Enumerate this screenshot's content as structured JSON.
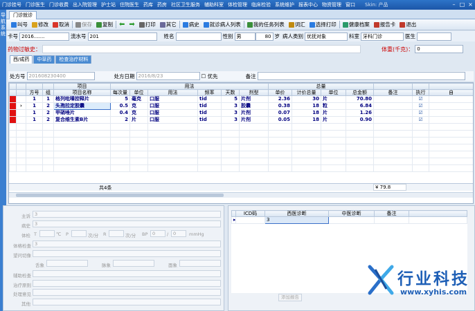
{
  "top_menu": [
    "门诊挂号",
    "门诊医生",
    "门诊收费",
    "出入院管理",
    "护士站",
    "住院医生",
    "药库",
    "药房",
    "社区卫生服务",
    "辅助科室",
    "体检管理",
    "临床检验",
    "系统维护",
    "报表中心",
    "物资管理",
    "窗口"
  ],
  "window_title_small": "Skin: 产品",
  "left_strip": "导航系统",
  "tab_main": "门诊就诊",
  "toolbar": {
    "items": [
      "叫号",
      "修改",
      "取消",
      "保存",
      "复制",
      "",
      "打印",
      "其它",
      "病史",
      "就诊病人列表",
      "我的任务列表",
      "词汇",
      "选择打印",
      "健康档案",
      "报告卡",
      "退出"
    ]
  },
  "patient": {
    "card_label": "卡号",
    "card_value": "2016.......",
    "serial_label": "流水号",
    "serial_value": "201",
    "name_label": "姓名",
    "name_value": "",
    "sex_label": "性别",
    "sex_value": "男",
    "age_value": "80",
    "age_unit": "岁",
    "category_label": "病人类别",
    "category_value": "优抚对象",
    "dept_label": "科室",
    "dept_value": "牙科门诊",
    "doctor_label": "医生",
    "doctor_value": ""
  },
  "allergy_label": "药物过敏史：",
  "weight_label": "体重(千克)：",
  "weight_value": "0",
  "sub_tabs": [
    "西/成药",
    "中草药",
    "检查治疗材料"
  ],
  "prescription": {
    "no_label": "处方号",
    "no_value": "201608230400",
    "date_label": "处方日期",
    "date_value": "2016/8/23",
    "priority_label": "优先",
    "note_label": "备注"
  },
  "grid": {
    "group_headers": {
      "project": "项目",
      "usage": "用法",
      "total": "总量"
    },
    "columns": [
      "方号",
      "组",
      "项目名称",
      "每次量",
      "单位",
      "用法",
      "频率",
      "天数",
      "剂型",
      "单价",
      "计价总量",
      "单位",
      "总金额",
      "备注",
      "执行",
      "自"
    ],
    "rows": [
      {
        "no": "1",
        "group": "1",
        "name": "格列吡嗪控释片",
        "dose": "5",
        "unit": "毫克",
        "route": "口服",
        "freq": "tid",
        "days": "5",
        "form": "片剂",
        "price": "2.36",
        "qty": "30",
        "qunit": "片",
        "amount": "70.80",
        "exec": "☑"
      },
      {
        "no": "1",
        "group": "2",
        "name": "头孢拉定胶囊",
        "dose": "0.5",
        "unit": "克",
        "route": "口服",
        "freq": "tid",
        "days": "3",
        "form": "胶囊",
        "price": "0.38",
        "qty": "18",
        "qunit": "粒",
        "amount": "6.84",
        "exec": "☑"
      },
      {
        "no": "1",
        "group": "2",
        "name": "甲硝唑片",
        "dose": "0.4",
        "unit": "克",
        "route": "口服",
        "freq": "tid",
        "days": "3",
        "form": "片剂",
        "price": "0.07",
        "qty": "18",
        "qunit": "片",
        "amount": "1.26",
        "exec": "☑"
      },
      {
        "no": "1",
        "group": "2",
        "name": "复合维生素B片",
        "dose": "2",
        "unit": "片",
        "route": "口服",
        "freq": "tid",
        "days": "3",
        "form": "片剂",
        "price": "0.05",
        "qty": "18",
        "qunit": "片",
        "amount": "0.90",
        "exec": "☑"
      }
    ],
    "footer_count": "共4条",
    "footer_total": "¥ 79.8"
  },
  "medical_record": {
    "chief": "主诉",
    "chief_value": "3",
    "history": "病史",
    "history_value": "3",
    "vitals_label": "体检",
    "T": "T",
    "T_unit": "℃",
    "P": "P",
    "P_unit": "次/分",
    "R": "R",
    "R_unit": "次/分",
    "BP": "BP",
    "BP_unit": "mmHg",
    "vitals_placeholder": "0",
    "exam": "体格检查",
    "exam_value": "3",
    "diag_history": "望问切像",
    "fields_row": [
      "舌象",
      "脉象",
      "面象"
    ],
    "aux": "辅助检查",
    "treat": "治疗原则",
    "handle": "处理意见",
    "other": "其他"
  },
  "diagnosis": {
    "columns": [
      "ICD码",
      "西医诊断",
      "中医诊断",
      "备注"
    ],
    "row": {
      "icd": "",
      "western": "3",
      "tcm": "",
      "note": ""
    },
    "button": "添加报告"
  },
  "watermark": {
    "cn": "行业科技",
    "en": "www.xyhis.com"
  },
  "colors": {
    "menu_bg": "#1c56a8",
    "accent": "#3b7fd0",
    "row_text": "#000080",
    "marker": "#e11111",
    "watermark": "#2a6fc9"
  }
}
